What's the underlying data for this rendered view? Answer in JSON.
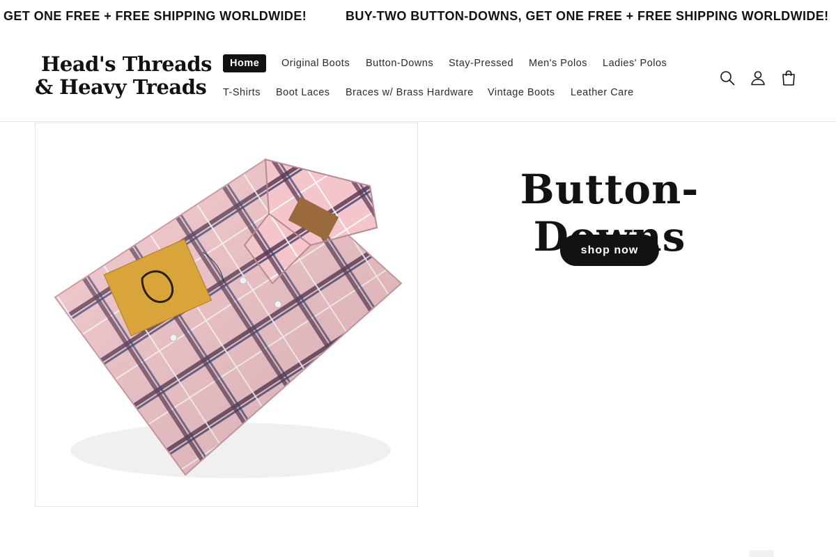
{
  "announcement": {
    "messages": [
      "GET ONE FREE + FREE SHIPPING WORLDWIDE!",
      "BUY-TWO BUTTON-DOWNS, GET ONE FREE + FREE SHIPPING WORLDWIDE!"
    ]
  },
  "header": {
    "logo_line1": "Head's Threads",
    "logo_line2": "& Heavy Treads",
    "nav": [
      {
        "label": "Home",
        "active": true
      },
      {
        "label": "Original Boots"
      },
      {
        "label": "Button-Downs"
      },
      {
        "label": "Stay-Pressed"
      },
      {
        "label": "Men's Polos"
      },
      {
        "label": "Ladies' Polos"
      },
      {
        "label": "T-Shirts"
      },
      {
        "label": "Boot Laces"
      },
      {
        "label": "Braces w/ Brass Hardware"
      },
      {
        "label": "Vintage Boots"
      },
      {
        "label": "Leather Care"
      }
    ],
    "icons": [
      "search-icon",
      "account-icon",
      "cart-icon"
    ]
  },
  "hero": {
    "title": "Button-Downs",
    "cta_label": "shop now",
    "image": "folded-pink-plaid-button-down-shirt"
  },
  "colors": {
    "text": "#121212",
    "button_bg": "#121212",
    "shirt_pink": "#f4c4c8",
    "plaid_dark": "#5b3a55",
    "plaid_navy": "#3a4170",
    "tag_gold": "#d9a53a"
  }
}
